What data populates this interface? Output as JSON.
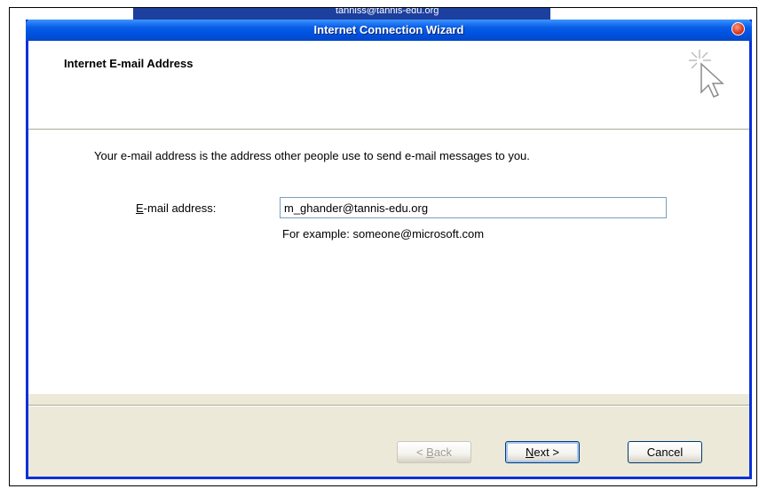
{
  "window": {
    "title": "Internet Connection Wizard",
    "background_title_fragment": "tanniss@tannis-edu.org"
  },
  "header": {
    "title": "Internet E-mail Address",
    "icon": "wizard-cursor-icon"
  },
  "body": {
    "description": "Your e-mail address is the address other people use to send e-mail messages to you.",
    "email_label_accesskey": "E",
    "email_label_rest": "-mail address:",
    "email_value": "m_ghander@tannis-edu.org",
    "example": "For example: someone@microsoft.com"
  },
  "buttons": {
    "back_prefix": "< ",
    "back_accesskey": "B",
    "back_rest": "ack",
    "next_accesskey": "N",
    "next_rest": "ext >",
    "cancel": "Cancel"
  },
  "colors": {
    "titlebar": "#0054e3",
    "window_border": "#0831d9",
    "dialog_bg": "#ece9d8"
  }
}
